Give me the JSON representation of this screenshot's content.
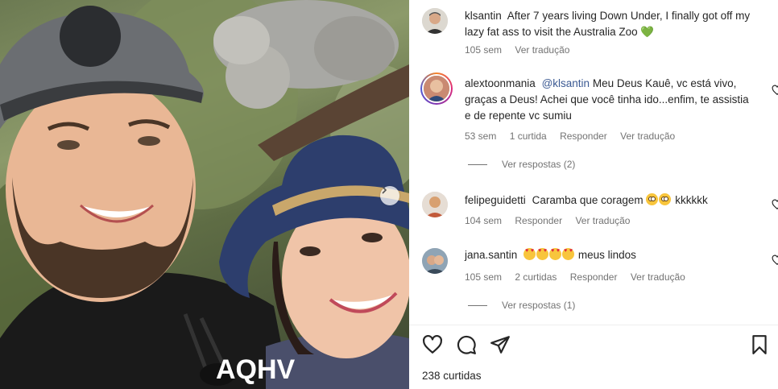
{
  "post": {
    "author": "klsantin",
    "caption": "After 7 years living Down Under, I finally got off my lazy fat ass to visit the Australia Zoo",
    "caption_emoji": "💚",
    "age": "105 sem",
    "translate": "Ver tradução"
  },
  "comments": [
    {
      "username": "alextoonmania",
      "mention": "@klsantin",
      "text": "Meu Deus Kauê, vc está vivo, graças a Deus! Achei que você tinha ido...enfim, te assistia e de repente vc sumiu",
      "age": "53 sem",
      "likes": "1 curtida",
      "reply": "Responder",
      "translate": "Ver tradução",
      "view_replies": "Ver respostas (2)"
    },
    {
      "username": "felipeguidetti",
      "text": "Caramba que coragem",
      "text_suffix": "kkkkkk",
      "age": "104 sem",
      "reply": "Responder",
      "translate": "Ver tradução"
    },
    {
      "username": "jana.santin",
      "text": "meus lindos",
      "age": "105 sem",
      "likes": "2 curtidas",
      "reply": "Responder",
      "translate": "Ver tradução",
      "view_replies": "Ver respostas (1)"
    }
  ],
  "footer": {
    "likes": "238 curtidas"
  },
  "photo": {
    "shirt_text": "AQHV"
  },
  "colors": {
    "mention": "#3c5a93",
    "meta": "#737373",
    "text": "#262626"
  }
}
